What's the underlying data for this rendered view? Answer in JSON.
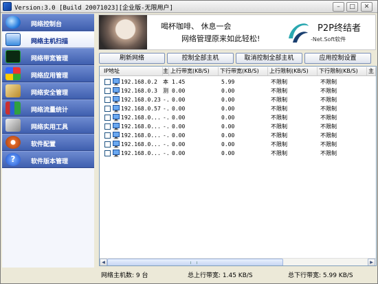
{
  "window": {
    "title": "Version:3.0 [Build 20071023][企业版-无限用户]"
  },
  "titlebar_buttons": {
    "min": "–",
    "max": "□",
    "close": "✕"
  },
  "sidebar": {
    "items": [
      {
        "label": "网络控制台",
        "icon": "globe-icon",
        "color": "#2a7fe0"
      },
      {
        "label": "网络主机扫描",
        "icon": "host-scan-icon",
        "color": "#3b8de0"
      },
      {
        "label": "网络带宽管理",
        "icon": "bandwidth-icon",
        "color": "#1f9a3a"
      },
      {
        "label": "网络应用管理",
        "icon": "windows-icon",
        "color": "#e0a020"
      },
      {
        "label": "网络安全管理",
        "icon": "tools-icon",
        "color": "#d9b85a"
      },
      {
        "label": "网络流量统计",
        "icon": "bar-chart-icon",
        "color": "#c93030"
      },
      {
        "label": "网络实用工具",
        "icon": "wrench-icon",
        "color": "#a0a0a0"
      },
      {
        "label": "软件配置",
        "icon": "config-icon",
        "color": "#e26a2a"
      },
      {
        "label": "软件版本管理",
        "icon": "help-icon",
        "color": "#2a6fe0"
      }
    ],
    "active_index": 1
  },
  "banner": {
    "line1": "喝杯咖啡、 休息一会",
    "line2": "网络管理原来如此轻松!",
    "brand": "P2P终结者",
    "sub": "-Net.Soft软件"
  },
  "toolbar": {
    "refresh": "刷新网络",
    "control_all": "控制全部主机",
    "cancel_all": "取消控制全部主机",
    "app_control": "应用控制设置"
  },
  "table": {
    "headers": [
      "IP地址",
      "主",
      "上行带宽(KB/S)",
      "下行带宽(KB/S)",
      "上行限制(KB/S)",
      "下行限制(KB/S)",
      "主"
    ],
    "rows": [
      {
        "ip": "192.168.0.2",
        "name": "本",
        "up": "1.45",
        "down": "5.99",
        "up_limit": "不限制",
        "down_limit": "不限制"
      },
      {
        "ip": "192.168.0.3",
        "name": "测",
        "up": "0.00",
        "down": "0.00",
        "up_limit": "不限制",
        "down_limit": "不限制"
      },
      {
        "ip": "192.168.0.23",
        "name": "-.",
        "up": "0.00",
        "down": "0.00",
        "up_limit": "不限制",
        "down_limit": "不限制"
      },
      {
        "ip": "192.168.0.57",
        "name": "-.",
        "up": "0.00",
        "down": "0.00",
        "up_limit": "不限制",
        "down_limit": "不限制"
      },
      {
        "ip": "192.168.0...",
        "name": "-.",
        "up": "0.00",
        "down": "0.00",
        "up_limit": "不限制",
        "down_limit": "不限制"
      },
      {
        "ip": "192.168.0...",
        "name": "-.",
        "up": "0.00",
        "down": "0.00",
        "up_limit": "不限制",
        "down_limit": "不限制"
      },
      {
        "ip": "192.168.0...",
        "name": "-.",
        "up": "0.00",
        "down": "0.00",
        "up_limit": "不限制",
        "down_limit": "不限制"
      },
      {
        "ip": "192.168.0...",
        "name": "-.",
        "up": "0.00",
        "down": "0.00",
        "up_limit": "不限制",
        "down_limit": "不限制"
      },
      {
        "ip": "192.168.0...",
        "name": "-.",
        "up": "0.00",
        "down": "0.00",
        "up_limit": "不限制",
        "down_limit": "不限制"
      }
    ]
  },
  "scrollbar": {
    "left_arrow": "◀",
    "right_arrow": "▶"
  },
  "status": {
    "hosts": "网络主机数: 9 台",
    "up_total": "总上行带宽:   1.45 KB/S",
    "down_total": "总下行带宽:   5.99 KB/S"
  }
}
